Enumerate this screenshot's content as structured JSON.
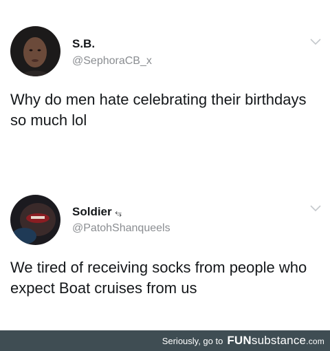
{
  "tweets": [
    {
      "display_name": "S.B.",
      "handle": "@SephoraCB_x",
      "text": "Why do men hate celebrating their birthdays so much lol",
      "avatar": "profile-photo"
    },
    {
      "display_name": "Soldier",
      "name_badge": "⥃",
      "handle": "@PatohShanqueels",
      "text": "We tired of receiving socks from people who expect Boat cruises from us",
      "avatar": "profile-photo"
    }
  ],
  "footer": {
    "text": "Seriously, go to",
    "brand_fun": "FUN",
    "brand_substance": "substance",
    "brand_dotcom": ".com"
  },
  "colors": {
    "background": "#ffffff",
    "text": "#14171a",
    "handle": "#8a8d91",
    "caret": "#c4c8cc",
    "footer_bg": "#3f4d53"
  },
  "icons": {
    "menu_caret": "chevron-down-icon"
  }
}
